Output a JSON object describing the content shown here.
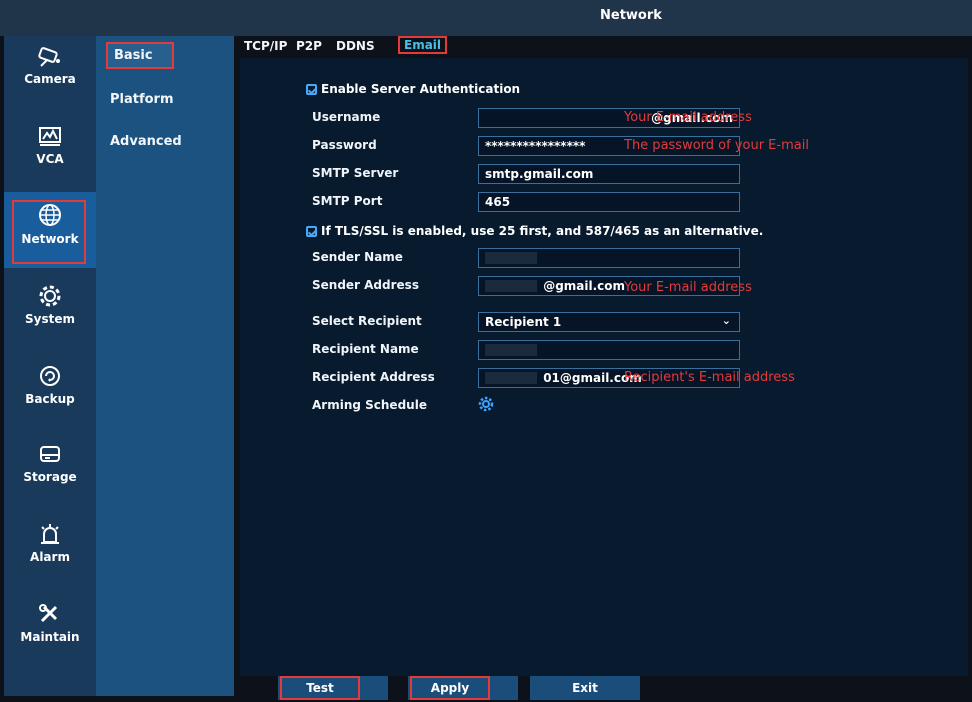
{
  "window": {
    "title": "Network"
  },
  "nav": {
    "items": [
      {
        "label": "Camera",
        "icon": "camera-icon"
      },
      {
        "label": "VCA",
        "icon": "vca-icon"
      },
      {
        "label": "Network",
        "icon": "network-globe-icon",
        "active": true
      },
      {
        "label": "System",
        "icon": "gear-icon"
      },
      {
        "label": "Backup",
        "icon": "backup-icon"
      },
      {
        "label": "Storage",
        "icon": "storage-icon"
      },
      {
        "label": "Alarm",
        "icon": "alarm-icon"
      },
      {
        "label": "Maintain",
        "icon": "wrench-icon"
      }
    ]
  },
  "subnav": {
    "items": [
      {
        "label": "Basic",
        "active": true
      },
      {
        "label": "Platform"
      },
      {
        "label": "Advanced"
      }
    ]
  },
  "tabs": [
    {
      "label": "TCP/IP"
    },
    {
      "label": "P2P"
    },
    {
      "label": "DDNS"
    },
    {
      "label": "Email",
      "active": true
    }
  ],
  "form": {
    "enable_auth": {
      "label": "Enable Server Authentication",
      "checked": true
    },
    "username": {
      "label": "Username",
      "value": "@gmail.com",
      "note": "Your E-mail address"
    },
    "password": {
      "label": "Password",
      "value": "****************",
      "note": "The password of your E-mail"
    },
    "smtp_server": {
      "label": "SMTP Server",
      "value": "smtp.gmail.com"
    },
    "smtp_port": {
      "label": "SMTP Port",
      "value": "465"
    },
    "tls": {
      "label": "If TLS/SSL is enabled, use 25 first, and 587/465 as an alternative.",
      "checked": true
    },
    "sender_name": {
      "label": "Sender Name",
      "value": ""
    },
    "sender_address": {
      "label": "Sender Address",
      "value": "@gmail.com",
      "note": "Your E-mail address"
    },
    "select_recipient": {
      "label": "Select Recipient",
      "value": "Recipient 1"
    },
    "recipient_name": {
      "label": "Recipient Name",
      "value": ""
    },
    "recipient_address": {
      "label": "Recipient Address",
      "value": "01@gmail.com",
      "note": "Recipient's E-mail address"
    },
    "arming_schedule": {
      "label": "Arming Schedule",
      "icon": "settings-gear-icon"
    }
  },
  "buttons": {
    "test": "Test",
    "apply": "Apply",
    "exit": "Exit"
  },
  "colors": {
    "highlight": "#e23b3b",
    "active_tab": "#48c0e8",
    "accent": "#1a5d9c"
  }
}
